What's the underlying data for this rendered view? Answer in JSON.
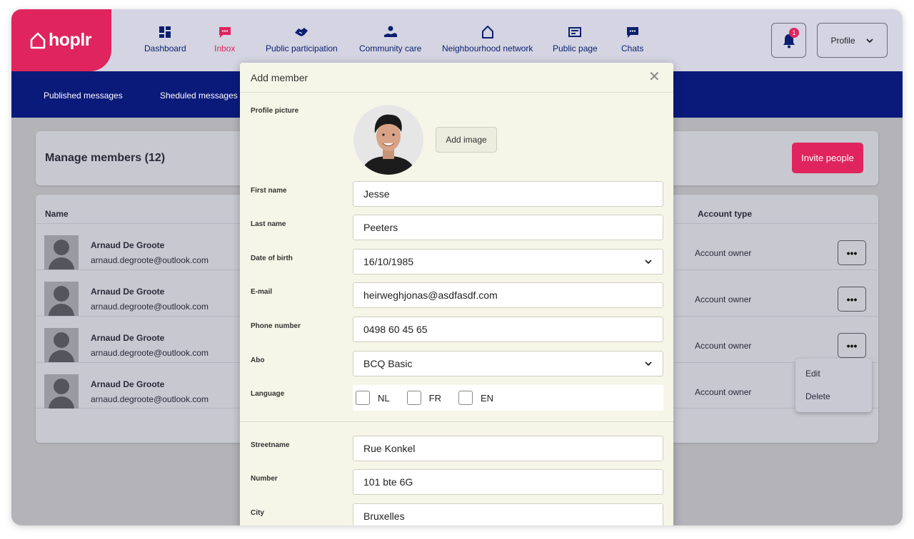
{
  "app": {
    "logo_text": "hoplr",
    "brand_color": "#e0245e",
    "nav_color": "#0a1a7a"
  },
  "topnav": {
    "items": [
      {
        "label": "Dashboard",
        "icon": "dashboard-icon"
      },
      {
        "label": "Inbox",
        "icon": "inbox-icon",
        "active": true
      },
      {
        "label": "Public participation",
        "icon": "handshake-icon"
      },
      {
        "label": "Community care",
        "icon": "care-hand-icon"
      },
      {
        "label": "Neighbourhood network",
        "icon": "house-icon"
      },
      {
        "label": "Public page",
        "icon": "newspaper-icon"
      },
      {
        "label": "Chats",
        "icon": "chat-icon"
      }
    ],
    "notifications_count": "1",
    "profile_label": "Profile"
  },
  "subnav": {
    "items": [
      "Published messages",
      "Sheduled messages"
    ]
  },
  "members": {
    "title": "Manage members (12)",
    "invite_label": "Invite people",
    "columns": {
      "name": "Name",
      "account_type": "Account type"
    },
    "rows": [
      {
        "name": "Arnaud De Groote",
        "email": "arnaud.degroote@outlook.com",
        "account_type": "Account owner"
      },
      {
        "name": "Arnaud De Groote",
        "email": "arnaud.degroote@outlook.com",
        "account_type": "Account owner"
      },
      {
        "name": "Arnaud De Groote",
        "email": "arnaud.degroote@outlook.com",
        "account_type": "Account owner"
      },
      {
        "name": "Arnaud De Groote",
        "email": "arnaud.degroote@outlook.com",
        "account_type": "Account owner"
      }
    ],
    "more_label": "•••",
    "context_menu": {
      "edit": "Edit",
      "delete": "Delete"
    }
  },
  "modal": {
    "title": "Add member",
    "close": "✕",
    "profile_picture_label": "Profile picture",
    "add_image_label": "Add image",
    "first_name": {
      "label": "First name",
      "value": "Jesse"
    },
    "last_name": {
      "label": "Last name",
      "value": "Peeters"
    },
    "dob": {
      "label": "Date of birth",
      "value": "16/10/1985"
    },
    "email": {
      "label": "E-mail",
      "value": "heirweghjonas@asdfasdf.com"
    },
    "phone": {
      "label": "Phone number",
      "value": "0498 60 45 65"
    },
    "abo": {
      "label": "Abo",
      "value": "BCQ Basic"
    },
    "language": {
      "label": "Language",
      "options": [
        "NL",
        "FR",
        "EN"
      ]
    },
    "street": {
      "label": "Streetname",
      "value": "Rue Konkel"
    },
    "number": {
      "label": "Number",
      "value": "101 bte 6G"
    },
    "city": {
      "label": "City",
      "value": "Bruxelles"
    }
  }
}
